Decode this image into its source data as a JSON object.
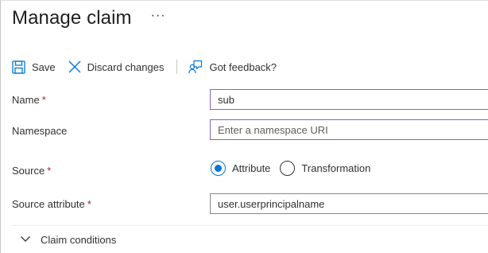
{
  "header": {
    "title": "Manage claim",
    "more_label": "···"
  },
  "toolbar": {
    "save_label": "Save",
    "save_icon": "floppy-disk-icon",
    "discard_label": "Discard changes",
    "discard_icon": "close-x-icon",
    "feedback_label": "Got feedback?",
    "feedback_icon": "feedback-person-icon"
  },
  "form": {
    "name": {
      "label": "Name",
      "required_mark": "*",
      "value": "sub"
    },
    "namespace": {
      "label": "Namespace",
      "value": "",
      "placeholder": "Enter a namespace URI"
    },
    "source": {
      "label": "Source",
      "required_mark": "*",
      "options": [
        {
          "label": "Attribute",
          "selected": true
        },
        {
          "label": "Transformation",
          "selected": false
        }
      ]
    },
    "source_attribute": {
      "label": "Source attribute",
      "required_mark": "*",
      "value": "user.userprincipalname"
    }
  },
  "conditions": {
    "label": "Claim conditions",
    "icon": "chevron-down-icon",
    "expanded": false
  },
  "colors": {
    "accent": "#0078d4",
    "focus_border": "#8764b8",
    "required": "#a4262c"
  }
}
